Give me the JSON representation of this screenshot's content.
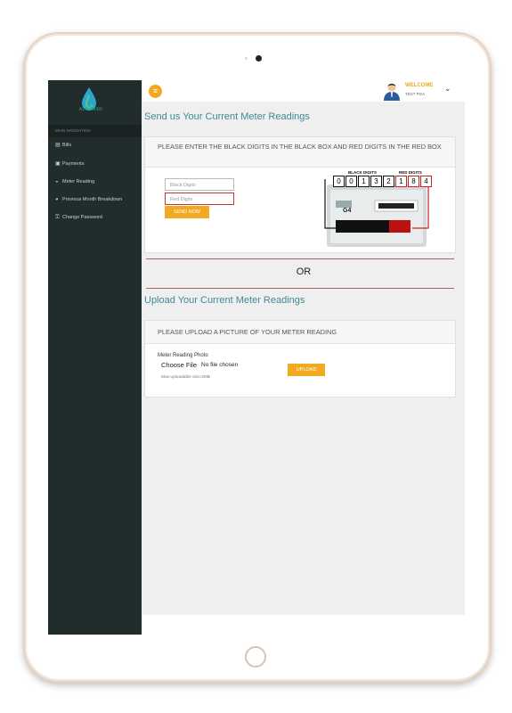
{
  "brand": {
    "logo_text": "AL FANAR"
  },
  "sidebar": {
    "section_header": "MAIN NAVIGATION",
    "items": [
      {
        "label": "Bills",
        "icon": "list-icon"
      },
      {
        "label": "Payments",
        "icon": "money-icon"
      },
      {
        "label": "Meter Reading",
        "icon": "gauge-icon"
      },
      {
        "label": "Previous Month Breakdown",
        "icon": "pie-icon"
      },
      {
        "label": "Change Password",
        "icon": "key-icon"
      }
    ]
  },
  "header": {
    "welcome": "WELCOME",
    "user": "TEST POA",
    "menu_icon": "hamburger-icon",
    "dropdown_icon": "chevron-down-icon"
  },
  "manual": {
    "title": "Send us Your Current Meter Readings",
    "instruction": "PLEASE ENTER THE BLACK DIGITS IN THE BLACK BOX AND RED DIGITS IN THE RED BOX",
    "black_placeholder": "Black Digits",
    "red_placeholder": "Red Digits",
    "send_button": "SEND NOW",
    "meter_image": {
      "black_label": "BLACK DIGITS",
      "red_label": "RED DIGITS",
      "digits": [
        "0",
        "0",
        "1",
        "3",
        "2",
        "1",
        "8",
        "4"
      ],
      "model": "G4"
    }
  },
  "separator": {
    "or": "OR"
  },
  "upload": {
    "title": "Upload Your Current Meter Readings",
    "instruction": "PLEASE UPLOAD A PICTURE OF YOUR METER READING",
    "field_label": "Meter Reading Photo",
    "choose_file": "Choose File",
    "no_file": "No file chosen",
    "max_size": "Max uploadable size:2MB",
    "upload_button": "UPLOAD"
  },
  "colors": {
    "accent": "#f2a81f",
    "sidebar": "#212c2c",
    "title": "#3e8a9a"
  }
}
